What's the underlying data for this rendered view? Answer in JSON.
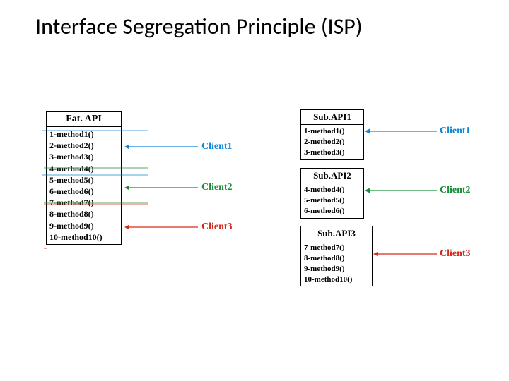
{
  "title": "Interface Segregation Principle (ISP)",
  "fat_api": {
    "header": "Fat. API",
    "methods": [
      "1-method1()",
      "2-method2()",
      "3-method3()",
      "4-method4()",
      "5-method5()",
      "6-method6()",
      "7-method7()",
      "8-method8()",
      "9-method9()",
      "10-method10()"
    ]
  },
  "sub_apis": [
    {
      "header": "Sub.API1",
      "methods": [
        "1-method1()",
        "2-method2()",
        "3-method3()"
      ]
    },
    {
      "header": "Sub.API2",
      "methods": [
        "4-method4()",
        "5-method5()",
        "6-method6()"
      ]
    },
    {
      "header": "Sub.API3",
      "methods": [
        "7-method7()",
        "8-method8()",
        "9-method9()",
        "10-method10()"
      ]
    }
  ],
  "clients_left": [
    "Client1",
    "Client2",
    "Client3"
  ],
  "clients_right": [
    "Client1",
    "Client2",
    "Client3"
  ],
  "colors": {
    "client1": "#1187d8",
    "client2": "#1a8f3a",
    "client3": "#d62a1a"
  }
}
